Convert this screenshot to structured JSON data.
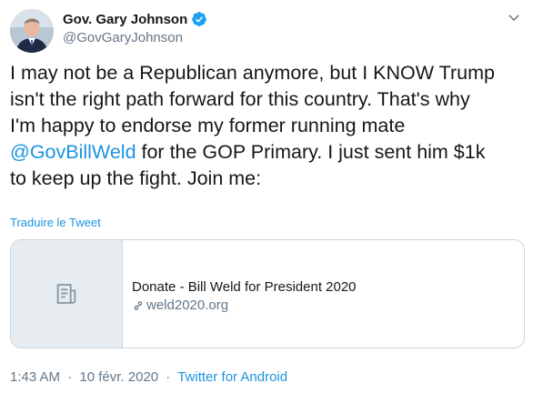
{
  "user": {
    "display_name": "Gov. Gary Johnson",
    "handle": "@GovGaryJohnson",
    "verified": true
  },
  "tweet": {
    "lines": [
      {
        "before": "I may not be a Republican anymore, but I KNOW Trump",
        "mention": "",
        "after": ""
      },
      {
        "before": "isn't the right path forward for this country. That's why",
        "mention": "",
        "after": ""
      },
      {
        "before": "I'm happy to endorse my former running mate",
        "mention": "",
        "after": ""
      },
      {
        "before": "",
        "mention": "@GovBillWeld",
        "after": " for the GOP Primary. I just sent him $1k"
      },
      {
        "before": "to keep up the fight. Join me:",
        "mention": "",
        "after": ""
      }
    ],
    "translate_label": "Traduire le Tweet"
  },
  "card": {
    "title": "Donate - Bill Weld for President 2020",
    "domain": "weld2020.org",
    "thumb_icon": "document-icon"
  },
  "meta": {
    "time": "1:43 AM",
    "separator": "·",
    "date": "10 févr. 2020",
    "source": "Twitter for Android"
  },
  "colors": {
    "accent": "#1b95e0",
    "verified": "#1da1f2",
    "secondary_text": "#657786",
    "primary_text": "#14171a",
    "border": "#ccd6dd",
    "card_thumb_bg": "#e6ecf0"
  },
  "icons": {
    "verified": "verified-badge-icon",
    "caret": "chevron-down-icon",
    "link": "link-icon",
    "thumb": "document-icon"
  }
}
